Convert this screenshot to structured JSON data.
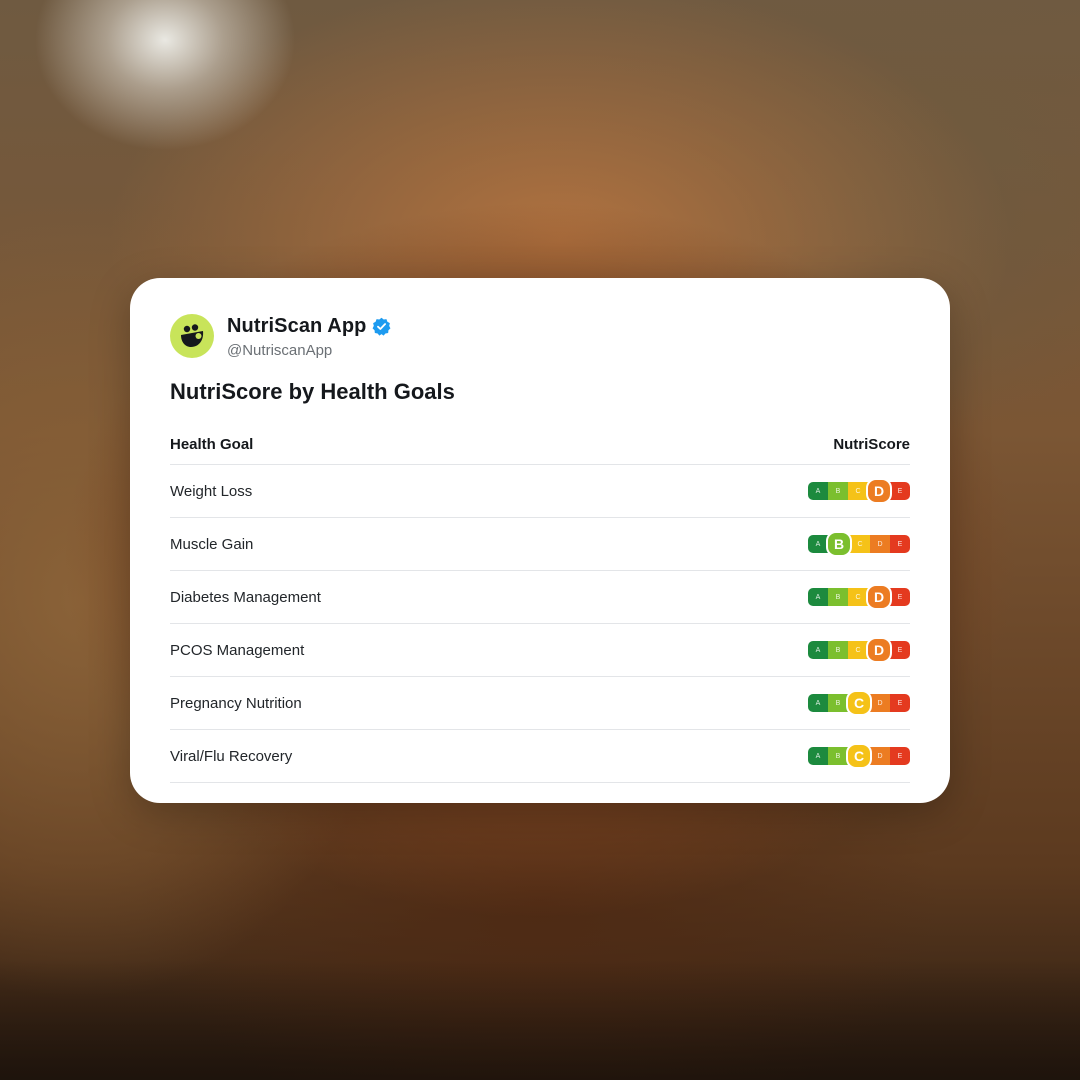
{
  "profile": {
    "name": "NutriScan App",
    "handle": "@NutriscanApp",
    "avatar_icon": "nutriscan-logo-icon",
    "verified_icon": "verified-badge-icon"
  },
  "post": {
    "title": "NutriScore by Health Goals"
  },
  "table": {
    "headers": {
      "goal": "Health Goal",
      "score": "NutriScore"
    },
    "grades": [
      "A",
      "B",
      "C",
      "D",
      "E"
    ],
    "rows": [
      {
        "goal": "Weight Loss",
        "score": "D"
      },
      {
        "goal": "Muscle Gain",
        "score": "B"
      },
      {
        "goal": "Diabetes Management",
        "score": "D"
      },
      {
        "goal": "PCOS Management",
        "score": "D"
      },
      {
        "goal": "Pregnancy Nutrition",
        "score": "C"
      },
      {
        "goal": "Viral/Flu Recovery",
        "score": "C"
      }
    ]
  },
  "colors": {
    "A": "#1c8a3e",
    "B": "#7bbf2e",
    "C": "#f5c218",
    "D": "#ec7c22",
    "E": "#e43a1f",
    "verified": "#1d9bf0",
    "logo_bg": "#c8e45a"
  }
}
